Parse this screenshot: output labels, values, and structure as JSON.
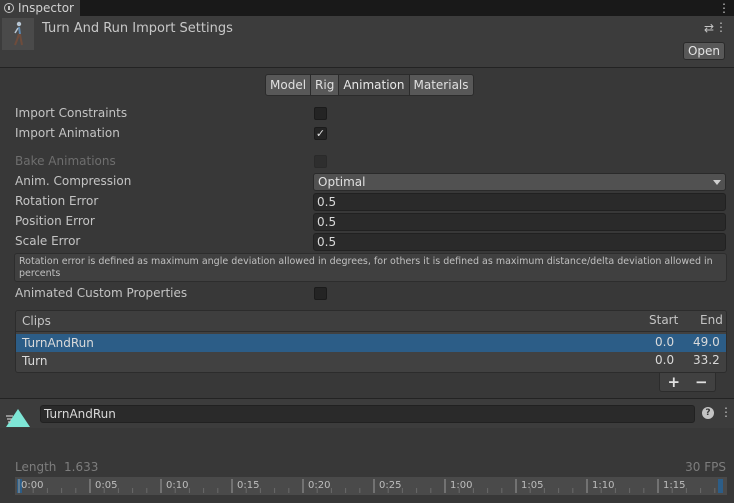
{
  "window": {
    "tab_title": "Inspector",
    "tab_icon": "info-icon",
    "menu_icon": "kebab-icon"
  },
  "header": {
    "title": "Turn And Run Import Settings",
    "open_label": "Open",
    "settings_icon": "sliders-icon",
    "menu_icon": "kebab-icon"
  },
  "toolbar": {
    "tabs": [
      "Model",
      "Rig",
      "Animation",
      "Materials"
    ],
    "active_tab": "Animation"
  },
  "props": {
    "import_constraints": {
      "label": "Import Constraints",
      "checked": false
    },
    "import_animation": {
      "label": "Import Animation",
      "checked": true,
      "check": "✓"
    },
    "bake_animations": {
      "label": "Bake Animations",
      "checked": false,
      "disabled": true
    },
    "anim_compression": {
      "label": "Anim. Compression",
      "value": "Optimal"
    },
    "rotation_error": {
      "label": "Rotation Error",
      "value": "0.5"
    },
    "position_error": {
      "label": "Position Error",
      "value": "0.5"
    },
    "scale_error": {
      "label": "Scale Error",
      "value": "0.5"
    },
    "help_text": "Rotation error is defined as maximum angle deviation allowed in degrees, for others it is defined as maximum distance/delta deviation allowed in percents",
    "animated_custom_properties": {
      "label": "Animated Custom Properties",
      "checked": false
    }
  },
  "clips": {
    "header": {
      "name": "Clips",
      "start": "Start",
      "end": "End"
    },
    "rows": [
      {
        "name": "TurnAndRun",
        "start": "0.0",
        "end": "49.0",
        "selected": true
      },
      {
        "name": "Turn",
        "start": "0.0",
        "end": "33.2",
        "selected": false
      }
    ],
    "add_label": "+",
    "remove_label": "−"
  },
  "clip_editor": {
    "name": "TurnAndRun",
    "help_label": "?",
    "menu_icon": "kebab-icon",
    "length_label": "Length",
    "length_value": "1.633",
    "fps": "30 FPS"
  },
  "timeline": {
    "labels": [
      "0:00",
      "0:05",
      "0:10",
      "0:15",
      "0:20",
      "0:25",
      "1:00",
      "1:05",
      "1:10",
      "1:15"
    ]
  },
  "colors": {
    "selection": "#2c5d87",
    "panel": "#383838",
    "header": "#3c3c3c",
    "accent_icon": "#7ee6d6"
  }
}
